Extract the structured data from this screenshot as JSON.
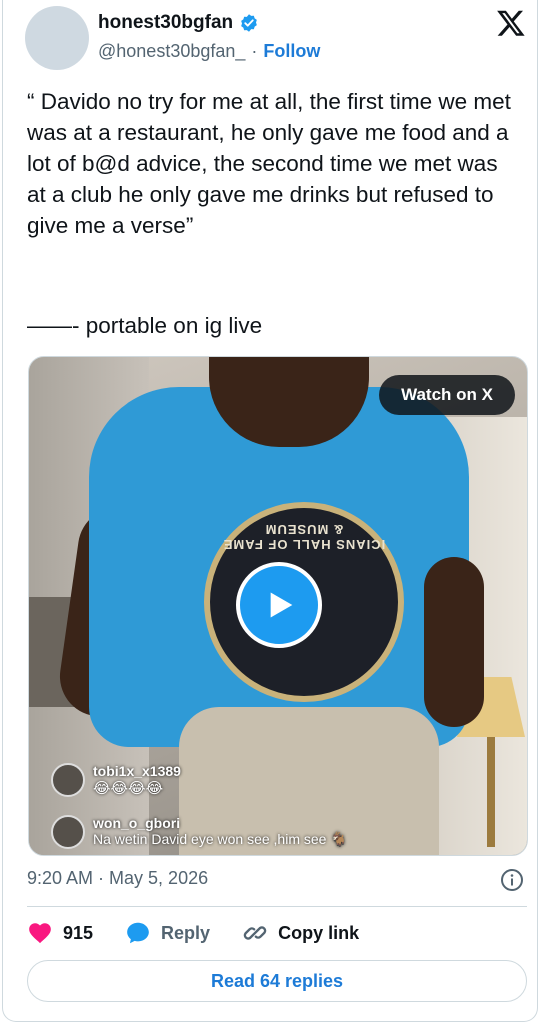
{
  "header": {
    "display_name": "honest30bgfan",
    "handle": "@honest30bgfan_",
    "separator": "·",
    "follow_label": "Follow",
    "verified": true
  },
  "tweet": {
    "text": "“ Davido no try for me at all, the first time we met was at a restaurant, he only gave me food and a lot of b@d advice, the second time we met was at a club he only gave me drinks but refused to give me a verse”",
    "signoff": "——- portable on ig live"
  },
  "media": {
    "watch_label": "Watch on X",
    "shirt_text": "ICIANS HALL OF FAME & MUSEUM",
    "comments": [
      {
        "user": "tobi1x_x1389",
        "message": "😂😂😂😂"
      },
      {
        "user": "won_o_gbori",
        "message": "Na wetin David eye won see ,him see 🐐"
      }
    ]
  },
  "meta": {
    "timestamp": "9:20 AM · May 5, 2026"
  },
  "actions": {
    "like_count": "915",
    "reply_label": "Reply",
    "copy_link_label": "Copy link"
  },
  "footer": {
    "read_replies_label": "Read 64 replies"
  },
  "colors": {
    "accent": "#1d9bf0",
    "link": "#1d7bd7",
    "like": "#f91880",
    "text_secondary": "#536471"
  }
}
